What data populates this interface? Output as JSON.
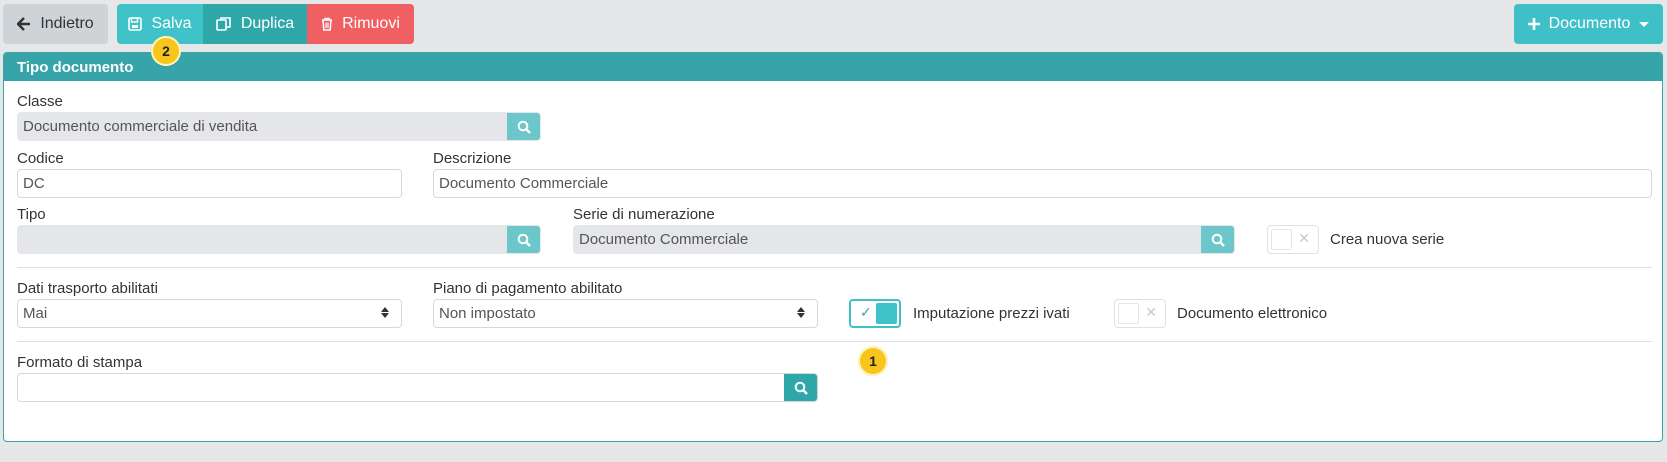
{
  "toolbar": {
    "back_label": "Indietro",
    "save_label": "Salva",
    "duplicate_label": "Duplica",
    "remove_label": "Rimuovi",
    "document_label": "Documento"
  },
  "badges": {
    "save": "2",
    "imputazione": "1"
  },
  "panel": {
    "title": "Tipo documento"
  },
  "form": {
    "classe": {
      "label": "Classe",
      "value": "Documento commerciale di vendita"
    },
    "codice": {
      "label": "Codice",
      "value": "DC"
    },
    "descrizione": {
      "label": "Descrizione",
      "value": "Documento Commerciale"
    },
    "tipo": {
      "label": "Tipo",
      "value": ""
    },
    "serie": {
      "label": "Serie di numerazione",
      "value": "Documento Commerciale"
    },
    "crea_nuova_serie": {
      "label": "Crea nuova serie",
      "checked": false
    },
    "dati_trasporto": {
      "label": "Dati trasporto abilitati",
      "value": "Mai"
    },
    "piano_pagamento": {
      "label": "Piano di pagamento abilitato",
      "value": "Non impostato"
    },
    "imputazione": {
      "label": "Imputazione prezzi ivati",
      "checked": true
    },
    "documento_elettronico": {
      "label": "Documento elettronico",
      "checked": false
    },
    "formato_stampa": {
      "label": "Formato di stampa",
      "value": ""
    }
  },
  "colors": {
    "accent": "#36a4a8",
    "save": "#3fc3c9",
    "duplicate": "#2fa7a9",
    "remove": "#f05f62",
    "badge": "#f7c51c"
  },
  "icons": {
    "back": "arrow-left-icon",
    "save": "floppy-disk-icon",
    "duplicate": "copy-icon",
    "remove": "trash-icon",
    "add": "plus-icon",
    "search": "search-icon"
  }
}
